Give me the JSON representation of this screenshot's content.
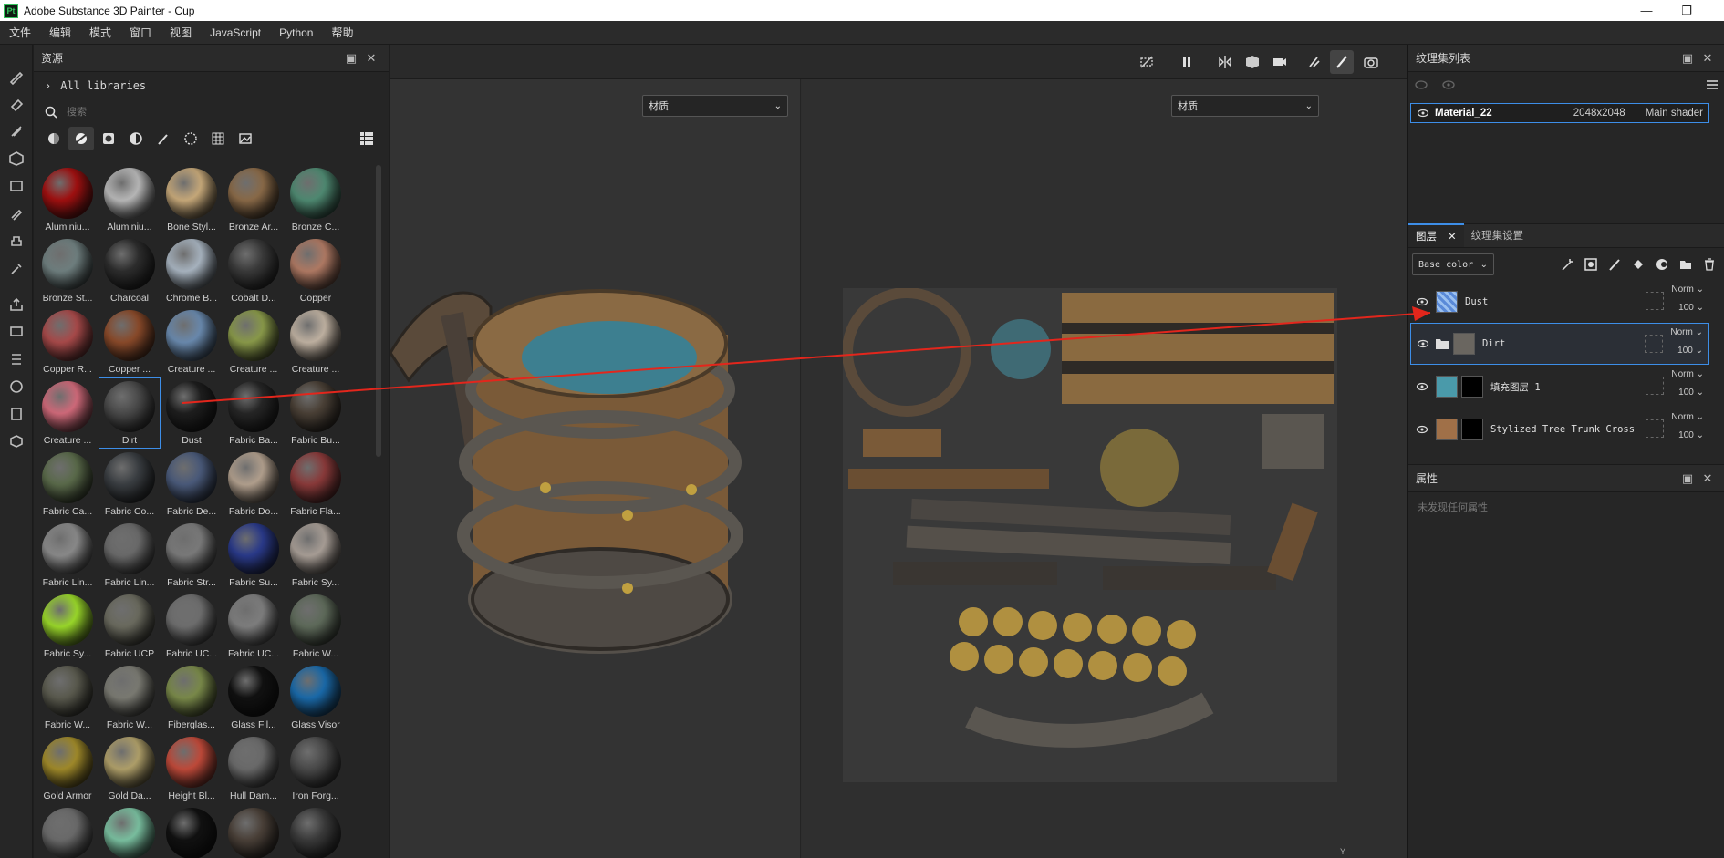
{
  "window": {
    "title": "Adobe Substance 3D Painter - Cup",
    "logo": "Pt"
  },
  "menu": [
    "文件",
    "编辑",
    "模式",
    "窗口",
    "视图",
    "JavaScript",
    "Python",
    "帮助"
  ],
  "assets": {
    "title": "资源",
    "library": "All libraries",
    "search_placeholder": "搜索",
    "materials": [
      {
        "label": "Aluminiu...",
        "c": "#a01010"
      },
      {
        "label": "Aluminiu...",
        "c": "#b8b8b8"
      },
      {
        "label": "Bone Styl...",
        "c": "#c7a97a"
      },
      {
        "label": "Bronze Ar...",
        "c": "#8a6a48"
      },
      {
        "label": "Bronze C...",
        "c": "#4f8a72"
      },
      {
        "label": "Bronze St...",
        "c": "#6f7f7f"
      },
      {
        "label": "Charcoal",
        "c": "#2d2d2d"
      },
      {
        "label": "Chrome B...",
        "c": "#a8b4c0"
      },
      {
        "label": "Cobalt D...",
        "c": "#3a3a3a"
      },
      {
        "label": "Copper",
        "c": "#b07a64"
      },
      {
        "label": "Copper R...",
        "c": "#a84a4a"
      },
      {
        "label": "Copper ...",
        "c": "#8a4a2a"
      },
      {
        "label": "Creature ...",
        "c": "#6a8aae"
      },
      {
        "label": "Creature ...",
        "c": "#8a9a4a"
      },
      {
        "label": "Creature ...",
        "c": "#c0b2a2"
      },
      {
        "label": "Creature ...",
        "c": "#d06a7a"
      },
      {
        "label": "Dirt",
        "c": "#4a4a4a"
      },
      {
        "label": "Dust",
        "c": "#1e1e1e"
      },
      {
        "label": "Fabric Ba...",
        "c": "#262626"
      },
      {
        "label": "Fabric Bu...",
        "c": "#4a4036"
      },
      {
        "label": "Fabric Ca...",
        "c": "#5a6a4a"
      },
      {
        "label": "Fabric Co...",
        "c": "#3a3e42"
      },
      {
        "label": "Fabric De...",
        "c": "#4a5a7a"
      },
      {
        "label": "Fabric Do...",
        "c": "#b2a08e"
      },
      {
        "label": "Fabric Fla...",
        "c": "#8a3a3a"
      },
      {
        "label": "Fabric Lin...",
        "c": "#8a8a8a"
      },
      {
        "label": "Fabric Lin...",
        "c": "#6a6a6a"
      },
      {
        "label": "Fabric Str...",
        "c": "#7a7a7a"
      },
      {
        "label": "Fabric Su...",
        "c": "#2a3a8a"
      },
      {
        "label": "Fabric Sy...",
        "c": "#a89e96"
      },
      {
        "label": "Fabric Sy...",
        "c": "#9ad82a"
      },
      {
        "label": "Fabric UCP",
        "c": "#6a6a5e"
      },
      {
        "label": "Fabric UC...",
        "c": "#6e6e6e"
      },
      {
        "label": "Fabric UC...",
        "c": "#7e7e7e"
      },
      {
        "label": "Fabric W...",
        "c": "#5e6a5a"
      },
      {
        "label": "Fabric W...",
        "c": "#5a5a4e"
      },
      {
        "label": "Fabric W...",
        "c": "#7a7a72"
      },
      {
        "label": "Fiberglas...",
        "c": "#7a8a4a"
      },
      {
        "label": "Glass Fil...",
        "c": "#111111"
      },
      {
        "label": "Glass Visor",
        "c": "#1a6aaa"
      },
      {
        "label": "Gold Armor",
        "c": "#a08a2a"
      },
      {
        "label": "Gold Da...",
        "c": "#b0a06a"
      },
      {
        "label": "Height Bl...",
        "c": "#c04a3a"
      },
      {
        "label": "Hull Dam...",
        "c": "#6a6a6a"
      },
      {
        "label": "Iron Forg...",
        "c": "#4a4a4a"
      },
      {
        "label": "",
        "c": "#6a6a6a"
      },
      {
        "label": "",
        "c": "#7ac0a0"
      },
      {
        "label": "",
        "c": "#111111"
      },
      {
        "label": "",
        "c": "#4a4038"
      },
      {
        "label": "",
        "c": "#3a3a3a"
      }
    ]
  },
  "viewport": {
    "left_dropdown": "材质",
    "right_dropdown": "材质",
    "axis_label": "Y"
  },
  "texture_sets": {
    "title": "纹理集列表",
    "row": {
      "name": "Material_22",
      "resolution": "2048x2048",
      "shader": "Main shader"
    }
  },
  "layers": {
    "tab_layers": "图层",
    "tab_settings": "纹理集设置",
    "channel": "Base color",
    "rows": [
      {
        "name": "Dust",
        "blend": "Norm",
        "opacity": "100"
      },
      {
        "name": "Dirt",
        "blend": "Norm",
        "opacity": "100"
      },
      {
        "name": "填充图层 1",
        "blend": "Norm",
        "opacity": "100"
      },
      {
        "name": "Stylized Tree Trunk Cross",
        "blend": "Norm",
        "opacity": "100"
      }
    ]
  },
  "properties": {
    "title": "属性",
    "empty_text": "未发现任何属性"
  },
  "colors": {
    "accent": "#3d8ee8",
    "arrow": "#e3261c"
  }
}
